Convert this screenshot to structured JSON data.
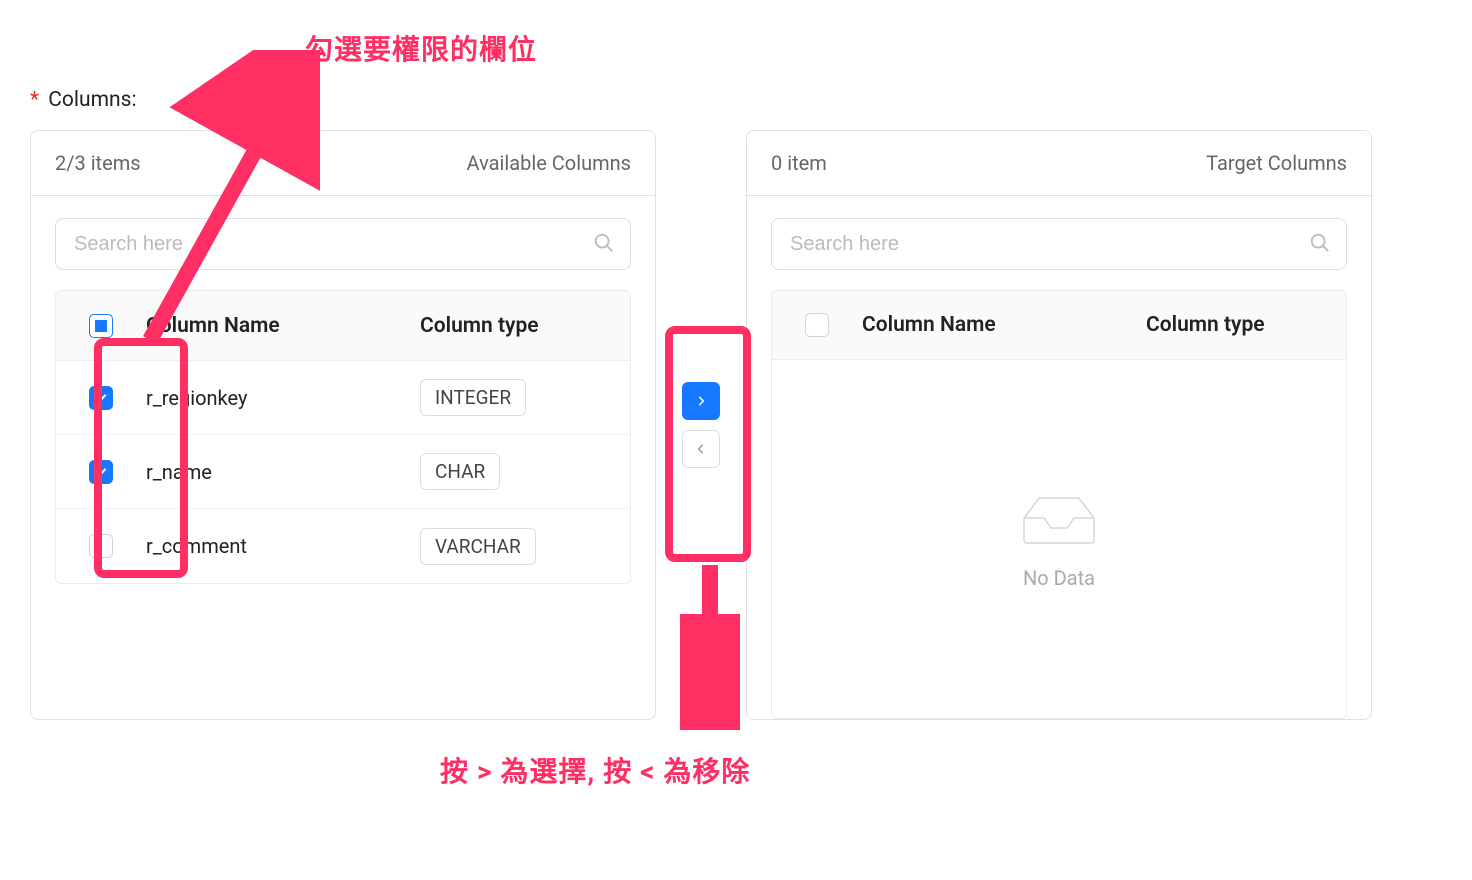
{
  "annotations": {
    "top": "勾選要權限的欄位",
    "bottom": "按 > 為選擇,  按 < 為移除"
  },
  "field": {
    "required_mark": "*",
    "label": "Columns:"
  },
  "source_panel": {
    "count_text": "2/3 items",
    "title": "Available Columns",
    "search_placeholder": "Search here",
    "header_col_name": "Column Name",
    "header_col_type": "Column type",
    "rows": [
      {
        "name": "r_regionkey",
        "type": "INTEGER",
        "checked": true
      },
      {
        "name": "r_name",
        "type": "CHAR",
        "checked": true
      },
      {
        "name": "r_comment",
        "type": "VARCHAR",
        "checked": false
      }
    ]
  },
  "target_panel": {
    "count_text": "0 item",
    "title": "Target Columns",
    "search_placeholder": "Search here",
    "header_col_name": "Column Name",
    "header_col_type": "Column type",
    "empty_text": "No Data"
  }
}
